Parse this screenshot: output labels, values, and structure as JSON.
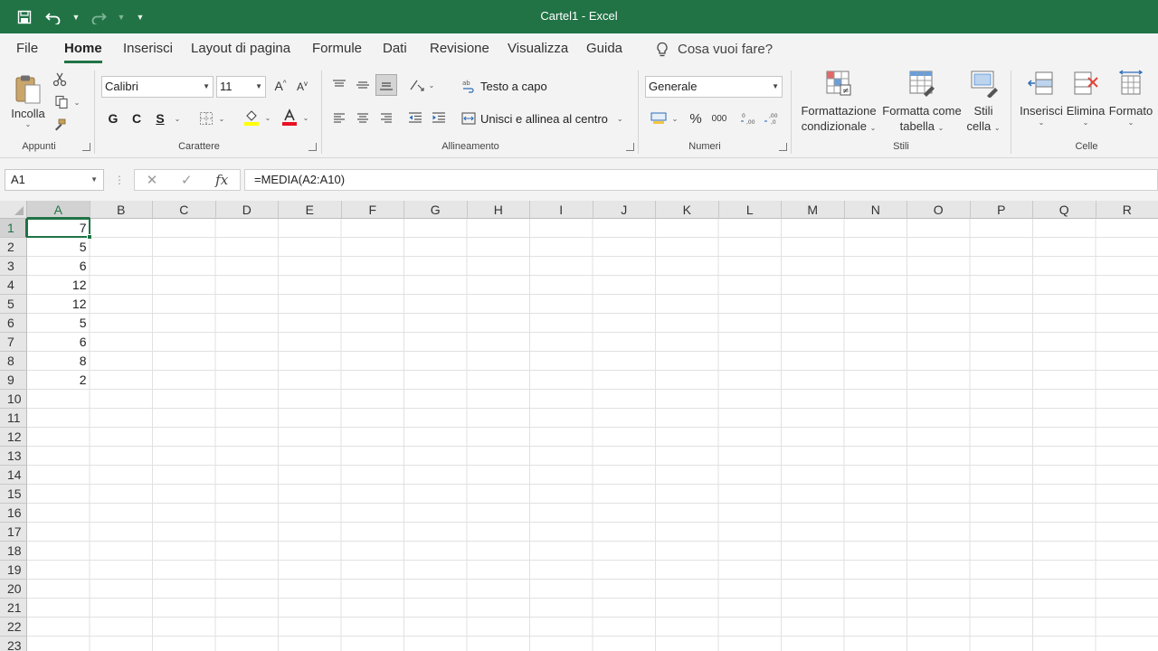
{
  "window": {
    "title": "Cartel1  -  Excel"
  },
  "menu": {
    "tabs": [
      "File",
      "Home",
      "Inserisci",
      "Layout di pagina",
      "Formule",
      "Dati",
      "Revisione",
      "Visualizza",
      "Guida"
    ],
    "active_tab": "Home",
    "tell_me": "Cosa vuoi fare?"
  },
  "ribbon": {
    "clipboard": {
      "label": "Appunti",
      "paste_label": "Incolla"
    },
    "font": {
      "label": "Carattere",
      "family": "Calibri",
      "size": "11",
      "bold": "G",
      "italic": "C",
      "underline": "S"
    },
    "alignment": {
      "label": "Allineamento",
      "wrap_text": "Testo a capo",
      "merge_center": "Unisci e allinea al centro"
    },
    "number": {
      "label": "Numeri",
      "format": "Generale",
      "percent": "%",
      "thousands": "000"
    },
    "styles": {
      "label": "Stili",
      "conditional_1": "Formattazione",
      "conditional_2": "condizionale",
      "as_table_1": "Formatta come",
      "as_table_2": "tabella",
      "cell_styles_1": "Stili",
      "cell_styles_2": "cella"
    },
    "cells": {
      "label": "Celle",
      "insert": "Inserisci",
      "delete": "Elimina",
      "format": "Formato"
    }
  },
  "formula_bar": {
    "name_box": "A1",
    "formula": "=MEDIA(A2:A10)"
  },
  "sheet": {
    "columns": [
      "A",
      "B",
      "C",
      "D",
      "E",
      "F",
      "G",
      "H",
      "I",
      "J",
      "K",
      "L",
      "M",
      "N",
      "O",
      "P",
      "Q",
      "R"
    ],
    "rows": [
      "1",
      "2",
      "3",
      "4",
      "5",
      "6",
      "7",
      "8",
      "9",
      "10",
      "11",
      "12",
      "13",
      "14",
      "15",
      "16",
      "17",
      "18",
      "19",
      "20",
      "21",
      "22",
      "23"
    ],
    "selected_cell": "A1",
    "column_a_values": [
      "7",
      "5",
      "6",
      "12",
      "12",
      "5",
      "6",
      "8",
      "2"
    ]
  },
  "colors": {
    "accent": "#217346",
    "title_bar": "#217346"
  }
}
